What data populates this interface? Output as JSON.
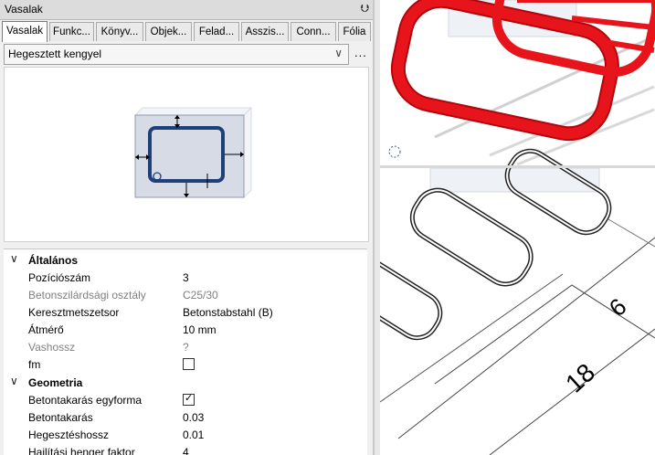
{
  "panel": {
    "title": "Vasalak",
    "pin_icon": "pin-icon",
    "tabs": [
      "Vasalak",
      "Funkc...",
      "Könyv...",
      "Objek...",
      "Felad...",
      "Asszis...",
      "Conn...",
      "Fólia"
    ],
    "active_tab": "Vasalak",
    "combo_value": "Hegesztett kengyel",
    "more_label": "..."
  },
  "properties": {
    "group1": "Általános",
    "group2": "Geometria",
    "rows": [
      {
        "key": "Pozíciószám",
        "value": "3"
      },
      {
        "key": "Betonszilárdsági osztály",
        "value": "C25/30"
      },
      {
        "key": "Keresztmetszetsor",
        "value": "Betonstabstahl (B)"
      },
      {
        "key": "Átmérő",
        "value": "10 mm"
      },
      {
        "key": "Vashossz",
        "value": "?"
      },
      {
        "key": "fm",
        "value": ""
      },
      {
        "key": "Betontakarás egyforma",
        "value": ""
      },
      {
        "key": "Betontakarás",
        "value": "0.03"
      },
      {
        "key": "Hegesztéshossz",
        "value": "0.01"
      },
      {
        "key": "Hajlítási henger faktor",
        "value": "4"
      }
    ]
  },
  "viewport": {
    "dim_label_1": "6",
    "dim_label_2": "18",
    "accent": "#e8141c"
  }
}
